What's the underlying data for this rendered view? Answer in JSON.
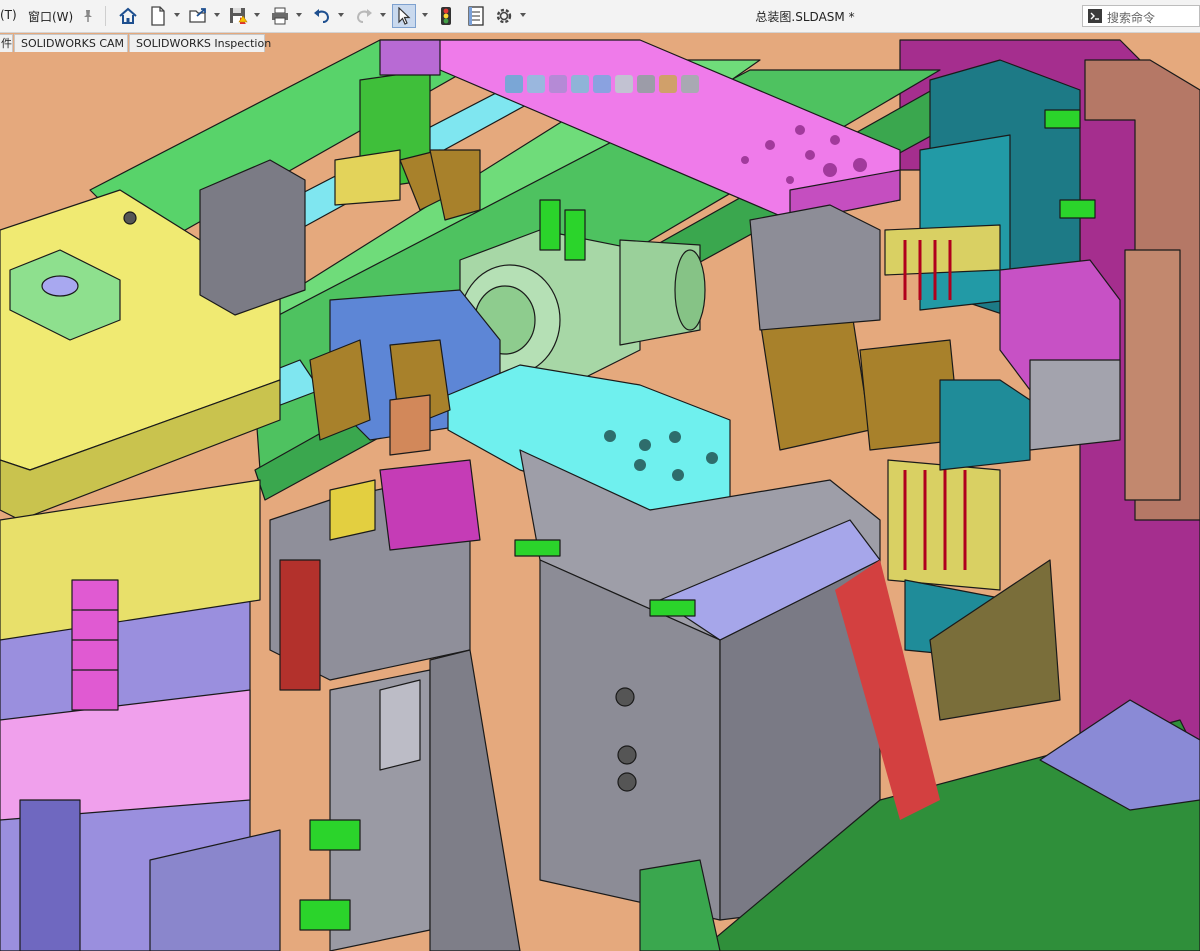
{
  "menu": {
    "partial_item": "(T)",
    "window": "窗口(W)"
  },
  "document": {
    "title": "总装图.SLDASM *"
  },
  "search": {
    "placeholder": "搜索命令"
  },
  "tabs": [
    {
      "label": "件"
    },
    {
      "label": "SOLIDWORKS CAM"
    },
    {
      "label": "SOLIDWORKS Inspection"
    }
  ],
  "toolbar": {
    "icons": [
      "pin-icon",
      "home-icon",
      "new-document-icon",
      "open-icon",
      "save-icon",
      "print-icon",
      "undo-icon",
      "redo-icon",
      "select-icon",
      "traffic-light-icon",
      "file-properties-icon",
      "options-icon"
    ]
  },
  "heads_up_toolbar": {
    "icons": [
      "zoom-to-fit-icon",
      "zoom-area-icon",
      "section-view-icon",
      "view-orientation-icon",
      "display-style-icon",
      "hide-show-icon",
      "appearance-icon",
      "scene-icon",
      "view-settings-icon"
    ]
  }
}
